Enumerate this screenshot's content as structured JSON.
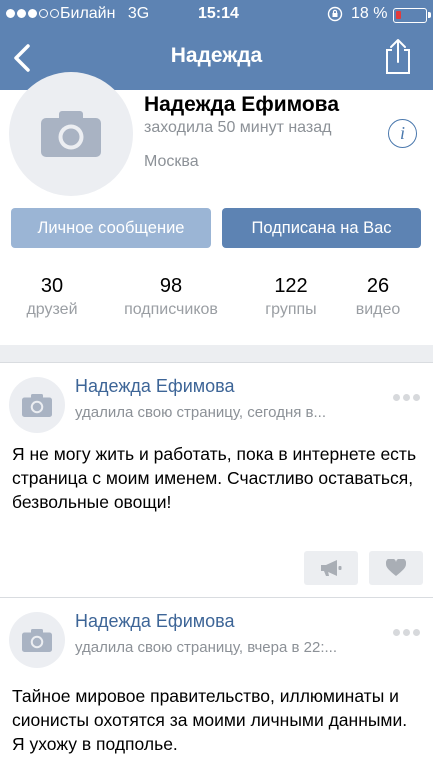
{
  "status_bar": {
    "carrier": "Билайн",
    "network": "3G",
    "time": "15:14",
    "battery_percent": "18 %",
    "battery_level": 0.18,
    "battery_color": "#e23b3b"
  },
  "nav": {
    "title": "Надежда",
    "back_icon": "chevron-left-icon",
    "share_icon": "share-icon"
  },
  "colors": {
    "header": "#5d83b3",
    "link": "#3d6597",
    "button_light": "#9bb5d5"
  },
  "profile": {
    "name": "Надежда Ефимова",
    "last_seen": "заходила 50 минут назад",
    "city": "Москва",
    "info_icon_text": "i",
    "message_button": "Личное сообщение",
    "subscribed_button": "Подписана на Вас",
    "stats": [
      {
        "value": "30",
        "label": "друзей"
      },
      {
        "value": "98",
        "label": "подписчиков"
      },
      {
        "value": "122",
        "label": "группы"
      },
      {
        "value": "26",
        "label": "видео"
      }
    ]
  },
  "posts": [
    {
      "author": "Надежда Ефимова",
      "meta": "удалила свою страницу, сегодня в...",
      "text": "Я не могу жить и работать, пока в интернете есть страница с моим именем. Счастливо оставаться, безвольные овощи!",
      "actions": [
        "megaphone-icon",
        "heart-icon"
      ]
    },
    {
      "author": "Надежда Ефимова",
      "meta": "удалила свою страницу, вчера в 22:...",
      "text": "Тайное мировое правительство, иллюминаты и сионисты охотятся за моими личными данными. Я ухожу в подполье."
    }
  ]
}
